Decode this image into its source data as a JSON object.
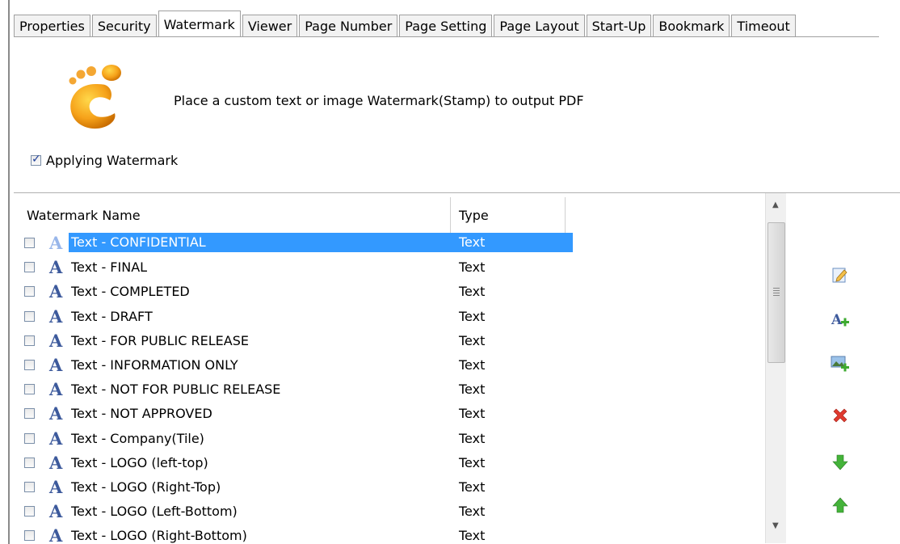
{
  "tabs": [
    {
      "label": "Properties",
      "active": false
    },
    {
      "label": "Security",
      "active": false
    },
    {
      "label": "Watermark",
      "active": true
    },
    {
      "label": "Viewer",
      "active": false
    },
    {
      "label": "Page Number",
      "active": false
    },
    {
      "label": "Page Setting",
      "active": false
    },
    {
      "label": "Page Layout",
      "active": false
    },
    {
      "label": "Start-Up",
      "active": false
    },
    {
      "label": "Bookmark",
      "active": false
    },
    {
      "label": "Timeout",
      "active": false
    }
  ],
  "header": {
    "description": "Place a custom text or image Watermark(Stamp) to output PDF"
  },
  "apply": {
    "label": "Applying Watermark",
    "checked": true
  },
  "table": {
    "columns": [
      "Watermark Name",
      "Type"
    ],
    "rows": [
      {
        "name": "Text - CONFIDENTIAL",
        "type": "Text",
        "checked": false,
        "selected": true
      },
      {
        "name": "Text - FINAL",
        "type": "Text",
        "checked": false,
        "selected": false
      },
      {
        "name": "Text - COMPLETED",
        "type": "Text",
        "checked": false,
        "selected": false
      },
      {
        "name": "Text - DRAFT",
        "type": "Text",
        "checked": false,
        "selected": false
      },
      {
        "name": "Text - FOR PUBLIC RELEASE",
        "type": "Text",
        "checked": false,
        "selected": false
      },
      {
        "name": "Text - INFORMATION ONLY",
        "type": "Text",
        "checked": false,
        "selected": false
      },
      {
        "name": "Text - NOT FOR PUBLIC RELEASE",
        "type": "Text",
        "checked": false,
        "selected": false
      },
      {
        "name": "Text - NOT APPROVED",
        "type": "Text",
        "checked": false,
        "selected": false
      },
      {
        "name": "Text - Company(Tile)",
        "type": "Text",
        "checked": false,
        "selected": false
      },
      {
        "name": "Text - LOGO (left-top)",
        "type": "Text",
        "checked": false,
        "selected": false
      },
      {
        "name": "Text - LOGO (Right-Top)",
        "type": "Text",
        "checked": false,
        "selected": false
      },
      {
        "name": "Text - LOGO (Left-Bottom)",
        "type": "Text",
        "checked": false,
        "selected": false
      },
      {
        "name": "Text - LOGO (Right-Bottom)",
        "type": "Text",
        "checked": false,
        "selected": false
      }
    ]
  },
  "side_buttons": [
    {
      "icon": "edit-icon"
    },
    {
      "icon": "add-text-icon"
    },
    {
      "icon": "add-image-icon"
    },
    {
      "icon": "delete-icon"
    },
    {
      "icon": "move-down-icon"
    },
    {
      "icon": "move-up-icon"
    }
  ],
  "colors": {
    "selection": "#3399ff",
    "accent_icon": "#3d5a9c"
  }
}
